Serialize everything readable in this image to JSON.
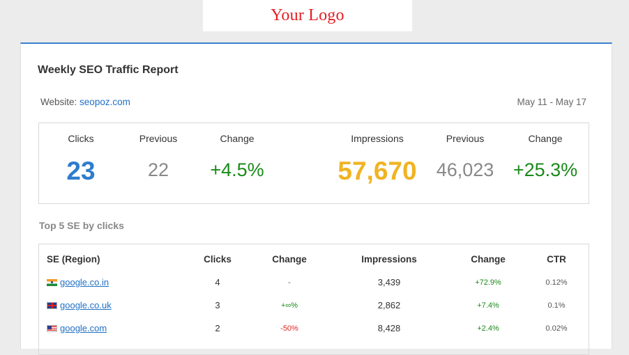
{
  "logo": {
    "text": "Your Logo"
  },
  "report": {
    "title": "Weekly SEO Traffic Report",
    "website_label": "Website:",
    "website_url": "seopoz.com",
    "date_range": "May 11 - May 17"
  },
  "summary": {
    "clicks_label": "Clicks",
    "clicks_value": "23",
    "clicks_previous_label": "Previous",
    "clicks_previous_value": "22",
    "clicks_change_label": "Change",
    "clicks_change_value": "+4.5%",
    "impressions_label": "Impressions",
    "impressions_value": "57,670",
    "impressions_previous_label": "Previous",
    "impressions_previous_value": "46,023",
    "impressions_change_label": "Change",
    "impressions_change_value": "+25.3%"
  },
  "top5": {
    "title": "Top 5 SE by clicks",
    "headers": {
      "se": "SE (Region)",
      "clicks": "Clicks",
      "change": "Change",
      "impressions": "Impressions",
      "imp_change": "Change",
      "ctr": "CTR"
    },
    "rows": [
      {
        "flag": "india-flag-icon",
        "se": "google.co.in",
        "clicks": "4",
        "change": "-",
        "change_color": "#555555",
        "impressions": "3,439",
        "imp_change": "+72.9%",
        "ctr": "0.12%"
      },
      {
        "flag": "uk-flag-icon",
        "se": "google.co.uk",
        "clicks": "3",
        "change": "+∞%",
        "change_color": "#1a8a1a",
        "impressions": "2,862",
        "imp_change": "+7.4%",
        "ctr": "0.1%"
      },
      {
        "flag": "us-flag-icon",
        "se": "google.com",
        "clicks": "2",
        "change": "-50%",
        "change_color": "#e02424",
        "impressions": "8,428",
        "imp_change": "+2.4%",
        "ctr": "0.02%"
      }
    ]
  },
  "colors": {
    "accent": "#3a7fd0",
    "clicks_blue": "#2e7dcc",
    "impressions_gold": "#f0b323",
    "positive_green": "#1a8a1a",
    "negative_red": "#e02424",
    "logo_red": "#e31e24"
  }
}
